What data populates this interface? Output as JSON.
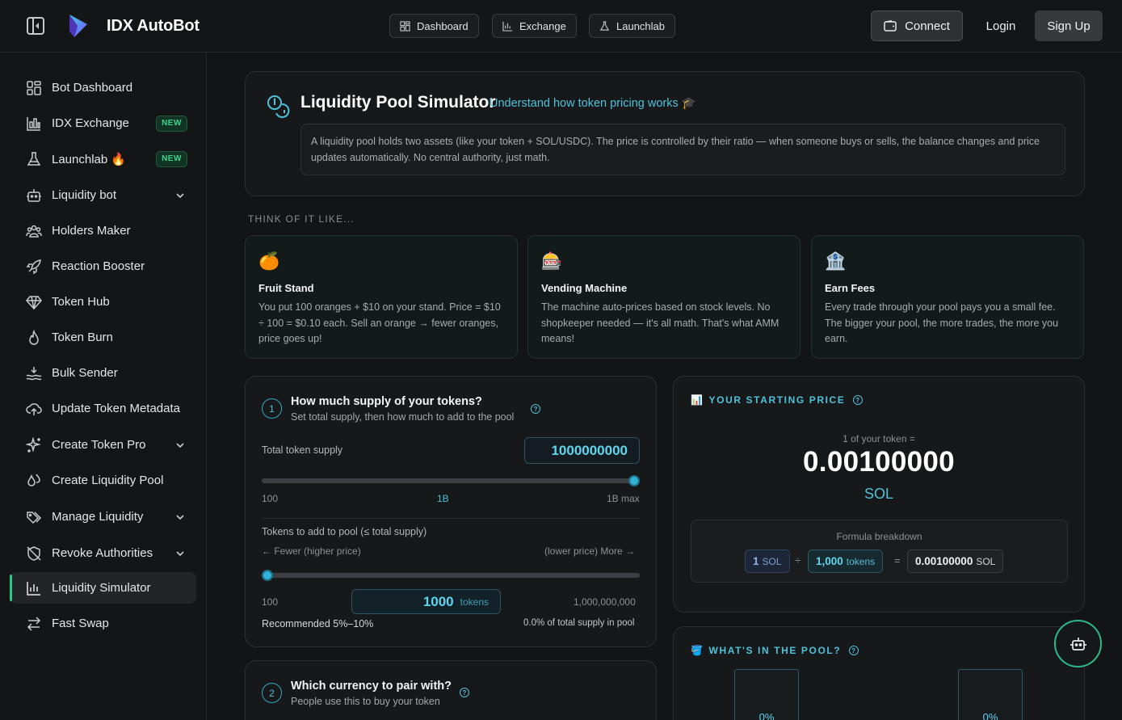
{
  "header": {
    "brand": "IDX AutoBot",
    "nav": [
      {
        "label": "Dashboard",
        "icon": "dashboard-icon"
      },
      {
        "label": "Exchange",
        "icon": "chart-icon"
      },
      {
        "label": "Launchlab",
        "icon": "flask-icon"
      }
    ],
    "connect_label": "Connect",
    "login_label": "Login",
    "signup_label": "Sign Up"
  },
  "sidebar": {
    "items": [
      {
        "label": "Bot Dashboard",
        "icon": "dashboard-icon"
      },
      {
        "label": "IDX Exchange",
        "icon": "chart-icon",
        "badge": "NEW"
      },
      {
        "label": "Launchlab 🔥",
        "icon": "flask-icon",
        "badge": "NEW"
      },
      {
        "label": "Liquidity bot",
        "icon": "bot-icon",
        "expandable": true
      },
      {
        "label": "Holders Maker",
        "icon": "users-icon"
      },
      {
        "label": "Reaction Booster",
        "icon": "rocket-icon"
      },
      {
        "label": "Token Hub",
        "icon": "diamond-icon"
      },
      {
        "label": "Token Burn",
        "icon": "flame-icon"
      },
      {
        "label": "Bulk Sender",
        "icon": "waves-icon"
      },
      {
        "label": "Update Token Metadata",
        "icon": "cloud-upload-icon"
      },
      {
        "label": "Create Token Pro",
        "icon": "sparkles-icon",
        "expandable": true
      },
      {
        "label": "Create Liquidity Pool",
        "icon": "droplets-icon"
      },
      {
        "label": "Manage Liquidity",
        "icon": "tags-icon",
        "expandable": true
      },
      {
        "label": "Revoke Authorities",
        "icon": "shield-off-icon",
        "expandable": true
      },
      {
        "label": "Liquidity Simulator",
        "icon": "bar-chart-icon",
        "active": true
      },
      {
        "label": "Fast Swap",
        "icon": "swap-icon"
      }
    ]
  },
  "intro": {
    "title": "Liquidity Pool Simulator",
    "subtitle": "Understand how token pricing works 🎓",
    "description": "A liquidity pool holds two assets (like your token + SOL/USDC). The price is controlled by their ratio — when someone buys or sells, the balance changes and price updates automatically. No central authority, just math."
  },
  "think": {
    "label": "THINK OF IT LIKE...",
    "cards": [
      {
        "emoji": "🍊",
        "title": "Fruit Stand",
        "text": "You put 100 oranges + $10 on your stand. Price = $10 ÷ 100 = $0.10 each. Sell an orange → fewer oranges, price goes up!"
      },
      {
        "emoji": "🎰",
        "title": "Vending Machine",
        "text": "The machine auto-prices based on stock levels. No shopkeeper needed — it's all math. That's what AMM means!"
      },
      {
        "emoji": "🏦",
        "title": "Earn Fees",
        "text": "Every trade through your pool pays you a small fee. The bigger your pool, the more trades, the more you earn."
      }
    ]
  },
  "step1": {
    "number": "1",
    "title": "How much supply of your tokens?",
    "subtitle": "Set total supply, then how much to add to the pool",
    "supply_label": "Total token supply",
    "supply_value": "1000000000",
    "supply_slider_fraction": 1.0,
    "supply_min": "100",
    "supply_mid": "1B",
    "supply_max": "1B max",
    "pool_label": "Tokens to add to pool (≤ total supply)",
    "fewer_label": "← Fewer (higher price)",
    "more_label": "(lower price) More →",
    "pool_slider_fraction": 0.0,
    "pool_min": "100",
    "pool_value": "1000",
    "pool_unit": "tokens",
    "pool_max": "1,000,000,000",
    "recommended": "Recommended 5%–10%",
    "percent_of_supply": "0.0% of total supply in pool"
  },
  "step2": {
    "number": "2",
    "title": "Which currency to pair with?",
    "subtitle": "People use this to buy your token"
  },
  "starting_price": {
    "heading": "YOUR STARTING PRICE",
    "heading_icon": "📊",
    "caption": "1 of your token =",
    "value": "0.00100000",
    "unit": "SOL",
    "formula_title": "Formula breakdown",
    "formula": {
      "a_value": "1",
      "a_unit": "SOL",
      "divide": "÷",
      "b_value": "1,000",
      "b_unit": "tokens",
      "equals": "=",
      "result_value": "0.00100000",
      "result_unit": "SOL"
    }
  },
  "pool": {
    "heading": "WHAT'S IN THE POOL?",
    "heading_icon": "🪣",
    "left_percent": "0%",
    "right_percent": "0%"
  }
}
